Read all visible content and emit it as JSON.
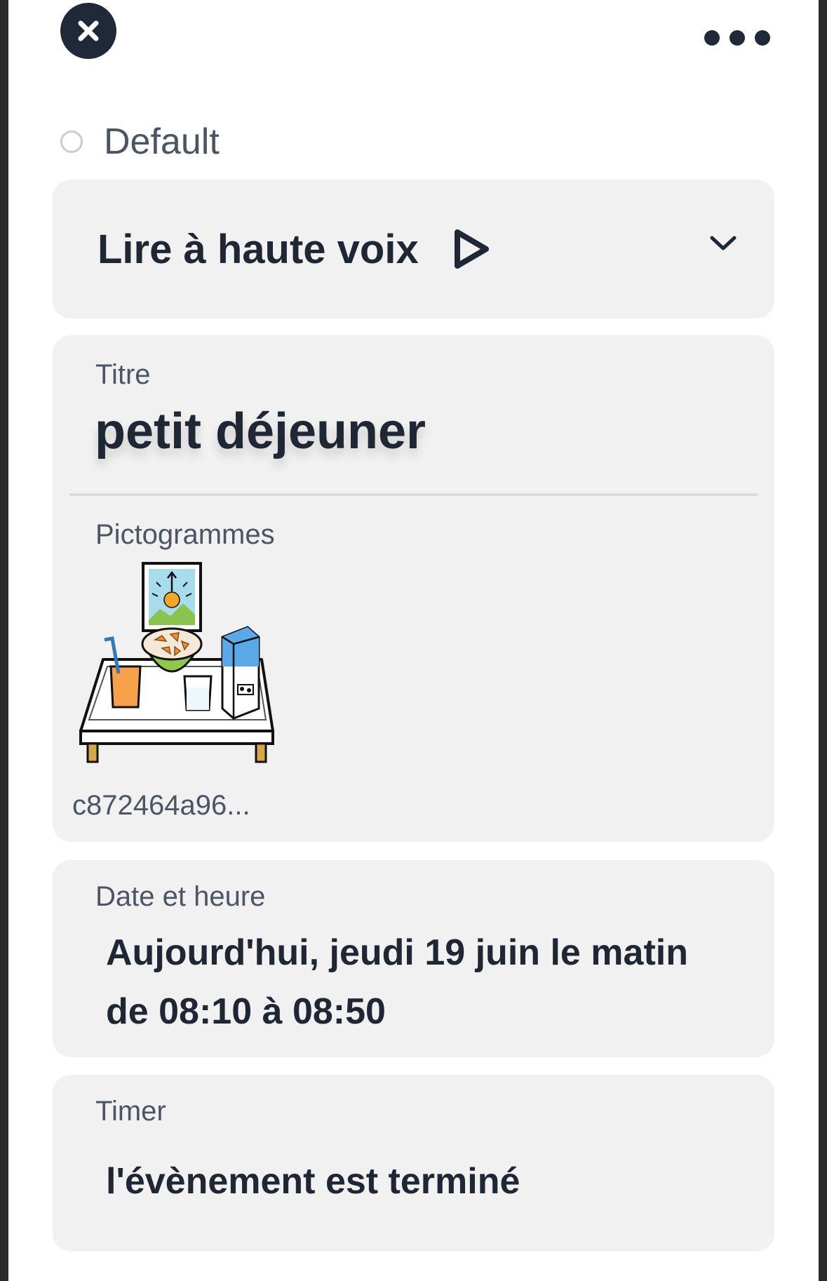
{
  "header": {
    "close_icon": "close-icon",
    "more_icon": "more-horizontal-icon"
  },
  "status": {
    "label": "Default",
    "selected": false
  },
  "tts": {
    "label": "Lire à haute voix",
    "play_icon": "play-icon",
    "expand_icon": "chevron-down-icon"
  },
  "details": {
    "title_label": "Titre",
    "title_value": "petit déjeuner",
    "pictograms_label": "Pictogrammes",
    "pictogram_caption": "c872464a96...",
    "pictogram_icon": "breakfast-pictogram"
  },
  "datetime": {
    "label": "Date et heure",
    "value": "Aujourd'hui, jeudi 19 juin le matin de 08:10 à 08:50"
  },
  "timer": {
    "label": "Timer",
    "value": "l'évènement est terminé"
  },
  "colors": {
    "card_bg": "#f1f1f1",
    "text_dark": "#1e2733",
    "text_muted": "#4b5563"
  }
}
